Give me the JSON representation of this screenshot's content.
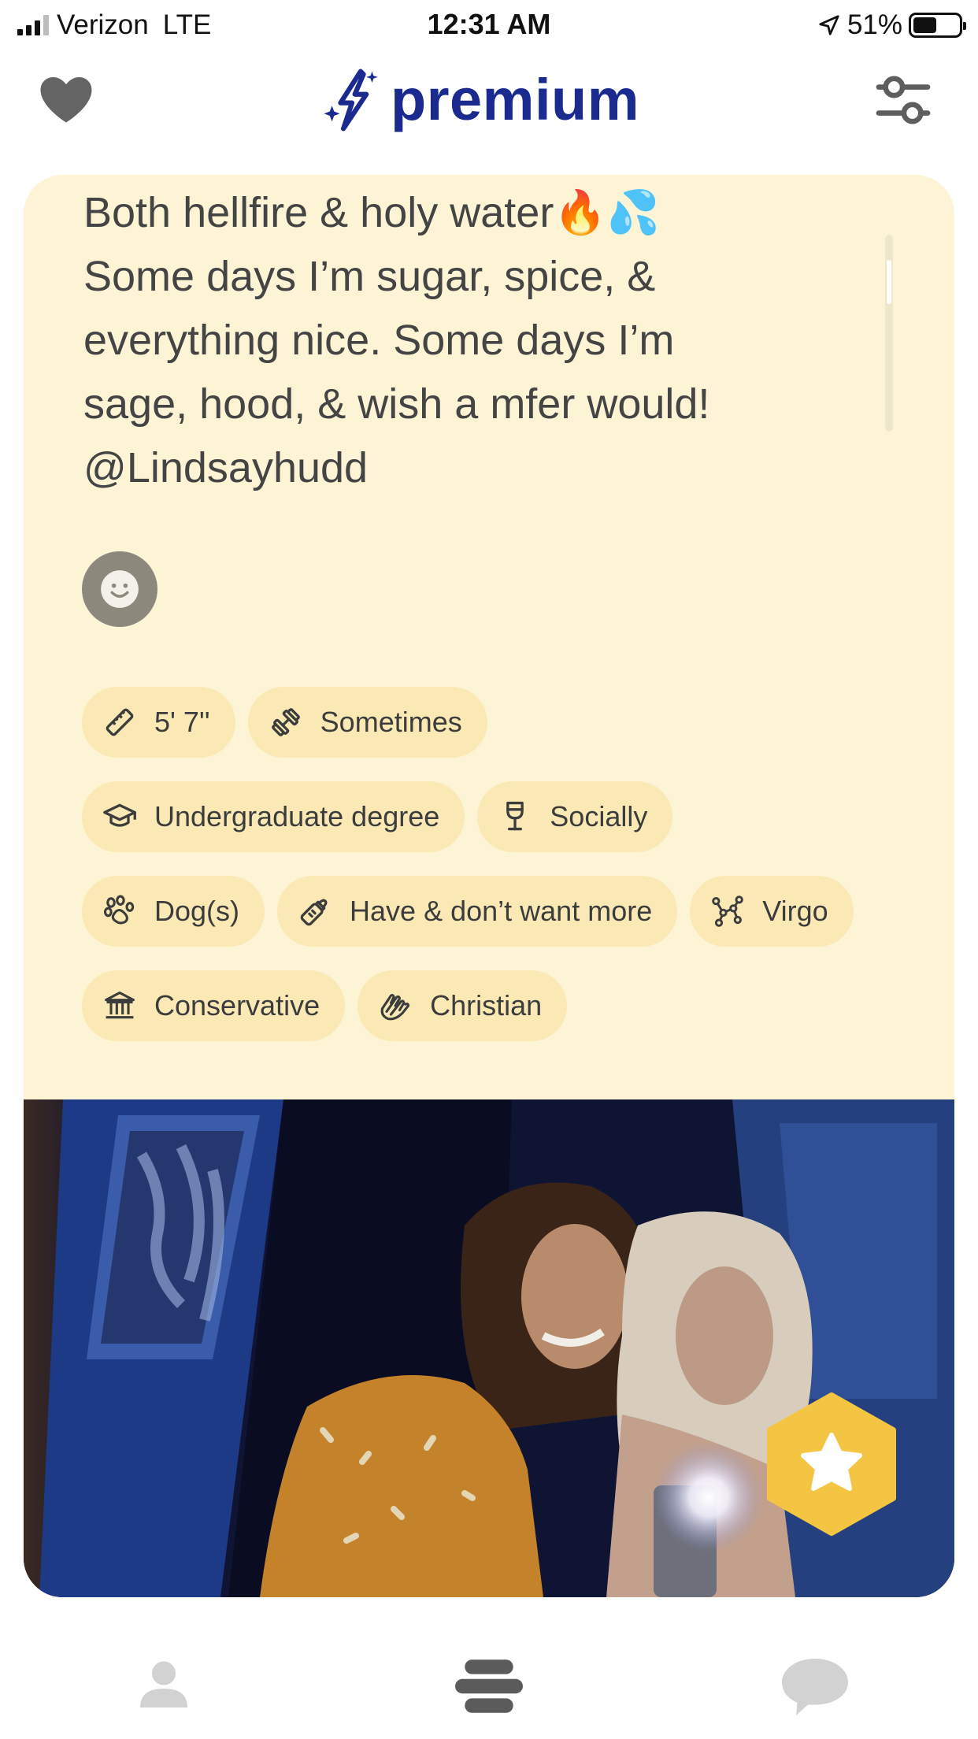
{
  "status_bar": {
    "carrier": "Verizon",
    "network": "LTE",
    "time": "12:31 AM",
    "battery": "51%",
    "battery_level": 0.51
  },
  "header": {
    "left_icon": "heart-icon",
    "title": "premium",
    "title_icon": "sparkle-bolt-icon",
    "right_icon": "filter-sliders-icon",
    "brand_color": "#1b2a8f"
  },
  "profile": {
    "bio_lines": [
      "Both hellfire & holy water🔥💦",
      "Some days I’m sugar, spice, &",
      "everything nice. Some days I’m",
      "sage, hood, & wish a mfer would!",
      "@Lindsayhudd"
    ],
    "emoji_button_icon": "smiley-icon",
    "chips": [
      {
        "icon": "ruler-icon",
        "label": "5' 7''"
      },
      {
        "icon": "dumbbell-icon",
        "label": "Sometimes"
      },
      {
        "icon": "graduation-cap-icon",
        "label": "Undergraduate degree"
      },
      {
        "icon": "wine-glass-icon",
        "label": "Socially"
      },
      {
        "icon": "paw-icon",
        "label": "Dog(s)"
      },
      {
        "icon": "baby-bottle-icon",
        "label": "Have & don’t want more"
      },
      {
        "icon": "constellation-icon",
        "label": "Virgo"
      },
      {
        "icon": "government-building-icon",
        "label": "Conservative"
      },
      {
        "icon": "praying-hands-icon",
        "label": "Christian"
      }
    ],
    "card_color": "#fdf4d6",
    "chip_color": "#fae9b4",
    "superswipe_icon": "star-icon",
    "superswipe_color": "#f4c542"
  },
  "bottom_nav": {
    "items": [
      "profile-icon",
      "discover-icon",
      "chat-icon"
    ],
    "active": "discover-icon"
  }
}
